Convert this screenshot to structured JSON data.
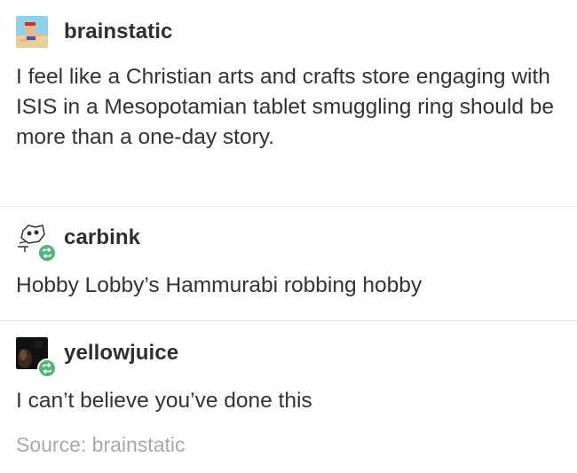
{
  "posts": [
    {
      "username": "brainstatic",
      "avatar_icon": "brainstatic-avatar-icon",
      "body": "I feel like a Christian arts and crafts store engaging with ISIS in a Mesopotamian tablet smuggling ring should be more than a one-day story.",
      "reblog": false
    },
    {
      "username": "carbink",
      "avatar_icon": "carbink-avatar-icon",
      "body": "Hobby Lobby’s Hammurabi robbing hobby",
      "reblog": true
    },
    {
      "username": "yellowjuice",
      "avatar_icon": "yellowjuice-avatar-icon",
      "body": "I can’t believe you’ve done this",
      "reblog": true
    }
  ],
  "source": {
    "text": "Source: brainstatic"
  },
  "colors": {
    "reblog_badge": "#53b37a",
    "divider": "#e6e6e6",
    "source_text": "#a8a8a8"
  }
}
